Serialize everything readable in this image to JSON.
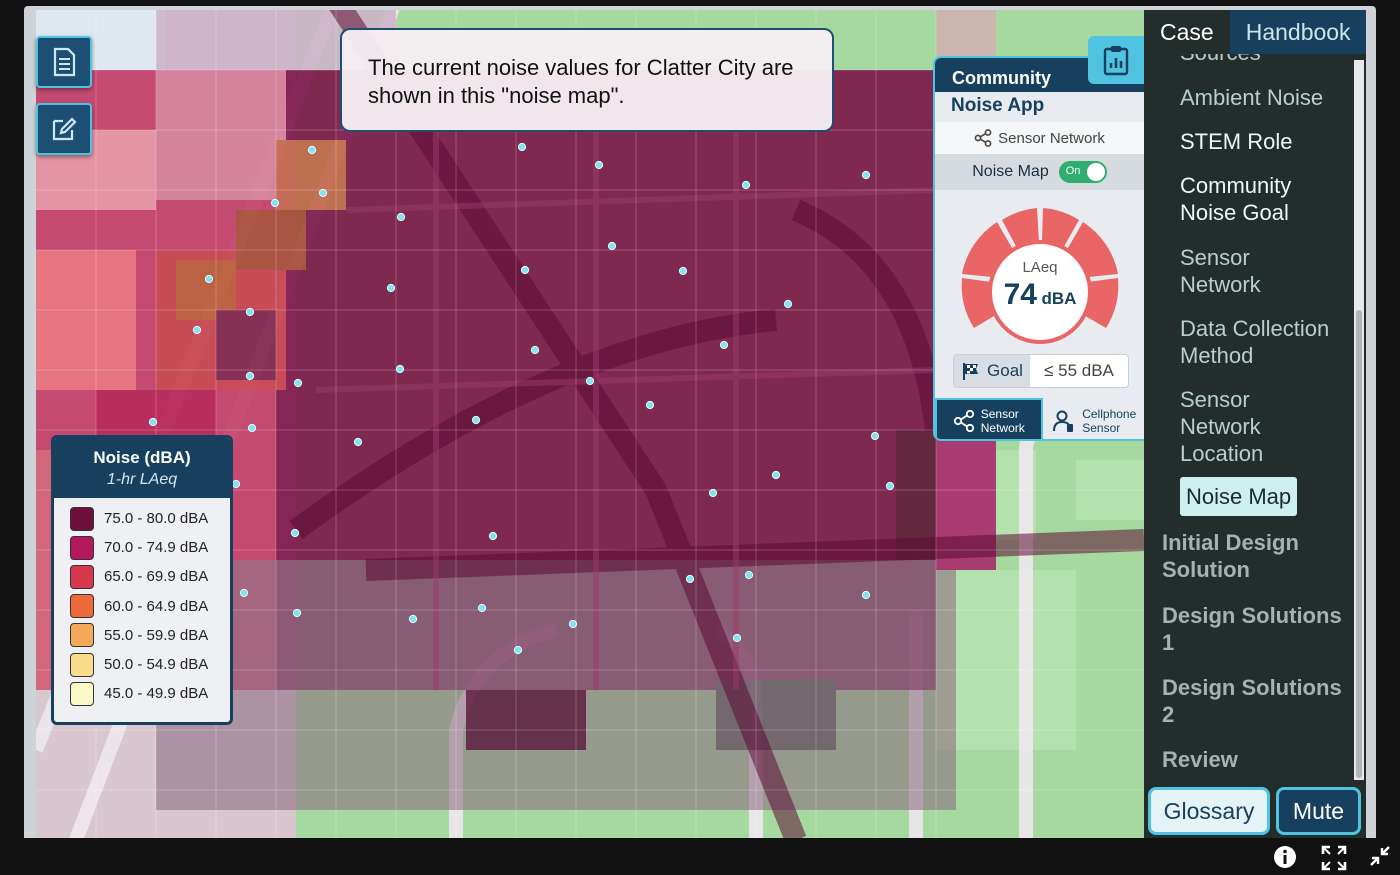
{
  "caption": "The current noise values for Clatter City are shown in this \"noise map\".",
  "legend": {
    "title": "Noise (dBA)",
    "subtitle": "1-hr LAeq",
    "items": [
      {
        "label": "75.0 - 80.0 dBA",
        "color": "#6e0f3d"
      },
      {
        "label": "70.0 - 74.9 dBA",
        "color": "#b3195c"
      },
      {
        "label": "65.0 - 69.9 dBA",
        "color": "#d8384d"
      },
      {
        "label": "60.0 - 64.9 dBA",
        "color": "#ee6a3a"
      },
      {
        "label": "55.0 - 59.9 dBA",
        "color": "#f4a85a"
      },
      {
        "label": "50.0 - 54.9 dBA",
        "color": "#f8dc8c"
      },
      {
        "label": "45.0 - 49.9 dBA",
        "color": "#fbf8c8"
      }
    ]
  },
  "app": {
    "title_line1": "Community",
    "title_line2": "Noise App",
    "sensor_network": "Sensor Network",
    "noise_map_label": "Noise Map",
    "toggle_state": "On",
    "gauge_label": "LAeq",
    "gauge_value": "74",
    "gauge_unit": "dBA",
    "goal_label": "Goal",
    "goal_value": "≤ 55 dBA",
    "tab_sensor": [
      "Sensor",
      "Network"
    ],
    "tab_cell": [
      "Cellphone",
      "Sensor"
    ]
  },
  "sidebar": {
    "tab_case": "Case",
    "tab_handbook": "Handbook",
    "partial_item": "Sources",
    "items": [
      "Ambient Noise",
      "STEM Role",
      "Community Noise Goal",
      "Sensor Network",
      "Data Collection Method",
      "Sensor Network Location"
    ],
    "active_item": "Noise Map",
    "sections": [
      "Initial Design Solution",
      "Design Solutions 1",
      "Design Solutions 2",
      "Review"
    ]
  },
  "buttons": {
    "glossary": "Glossary",
    "mute": "Mute"
  },
  "colors": {
    "navy": "#17405f",
    "cyan": "#4fc3e0",
    "sidebar_bg": "#232e2c"
  }
}
